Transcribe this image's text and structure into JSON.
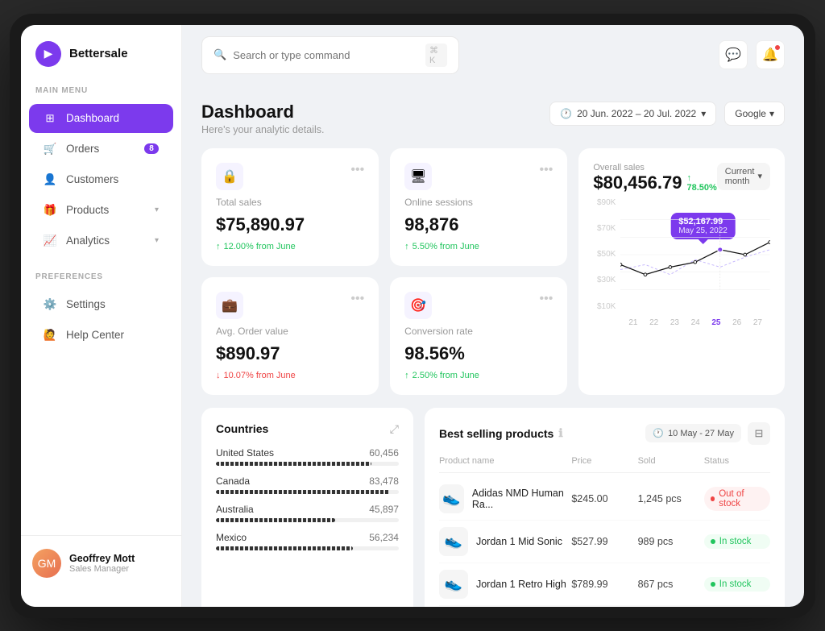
{
  "app": {
    "name": "Bettersale"
  },
  "topbar": {
    "search_placeholder": "Search or type command",
    "shortcut": "⌘ K"
  },
  "sidebar": {
    "section_main": "MAIN MENU",
    "section_prefs": "PREFERENCES",
    "nav_items": [
      {
        "id": "dashboard",
        "label": "Dashboard",
        "active": true
      },
      {
        "id": "orders",
        "label": "Orders",
        "badge": "8"
      },
      {
        "id": "customers",
        "label": "Customers"
      },
      {
        "id": "products",
        "label": "Products",
        "chevron": true
      },
      {
        "id": "analytics",
        "label": "Analytics",
        "chevron": true
      }
    ],
    "pref_items": [
      {
        "id": "settings",
        "label": "Settings"
      },
      {
        "id": "help",
        "label": "Help Center"
      }
    ],
    "user": {
      "name": "Geoffrey Mott",
      "role": "Sales Manager"
    }
  },
  "dashboard": {
    "title": "Dashboard",
    "subtitle": "Here's your analytic details.",
    "date_range": "20 Jun. 2022 – 20 Jul. 2022",
    "source": "Google"
  },
  "stats": [
    {
      "id": "total-sales",
      "label": "Total sales",
      "value": "$75,890.97",
      "change": "↑ 12.00% from June",
      "up": true,
      "icon": "🔒"
    },
    {
      "id": "online-sessions",
      "label": "Online sessions",
      "value": "98,876",
      "change": "↑ 5.50% from June",
      "up": true,
      "icon": "🖥"
    },
    {
      "id": "avg-order",
      "label": "Avg. Order value",
      "value": "$890.97",
      "change": "↓ 10.07% from June",
      "up": false,
      "icon": "💼"
    },
    {
      "id": "conversion",
      "label": "Conversion rate",
      "value": "98.56%",
      "change": "↑ 2.50% from June",
      "up": true,
      "icon": "📊"
    }
  ],
  "overall_sales": {
    "label": "Overall sales",
    "value": "$80,456.79",
    "trend": "↑ 78.50%",
    "period": "Current month",
    "tooltip_value": "$52,167.99",
    "tooltip_date": "May 25, 2022",
    "y_labels": [
      "$90K",
      "$70K",
      "$50K",
      "$30K",
      "$10K"
    ],
    "x_labels": [
      "21",
      "22",
      "23",
      "24",
      "25",
      "26",
      "27"
    ]
  },
  "countries": {
    "title": "Countries",
    "items": [
      {
        "name": "United States",
        "value": "60,456",
        "pct": 85
      },
      {
        "name": "Canada",
        "value": "83,478",
        "pct": 95
      },
      {
        "name": "Australia",
        "value": "45,897",
        "pct": 65
      },
      {
        "name": "Mexico",
        "value": "56,234",
        "pct": 75
      }
    ]
  },
  "best_selling": {
    "title": "Best selling products",
    "date_range": "10 May - 27 May",
    "columns": [
      "Product name",
      "Price",
      "Sold",
      "Status"
    ],
    "products": [
      {
        "name": "Adidas NMD Human Ra...",
        "price": "$245.00",
        "sold": "1,245 pcs",
        "status": "Out of stock",
        "in_stock": false,
        "emoji": "👟"
      },
      {
        "name": "Jordan 1 Mid Sonic",
        "price": "$527.99",
        "sold": "989 pcs",
        "status": "In stock",
        "in_stock": true,
        "emoji": "👟"
      },
      {
        "name": "Jordan 1 Retro High",
        "price": "$789.99",
        "sold": "867 pcs",
        "status": "In stock",
        "in_stock": true,
        "emoji": "👟"
      }
    ]
  }
}
